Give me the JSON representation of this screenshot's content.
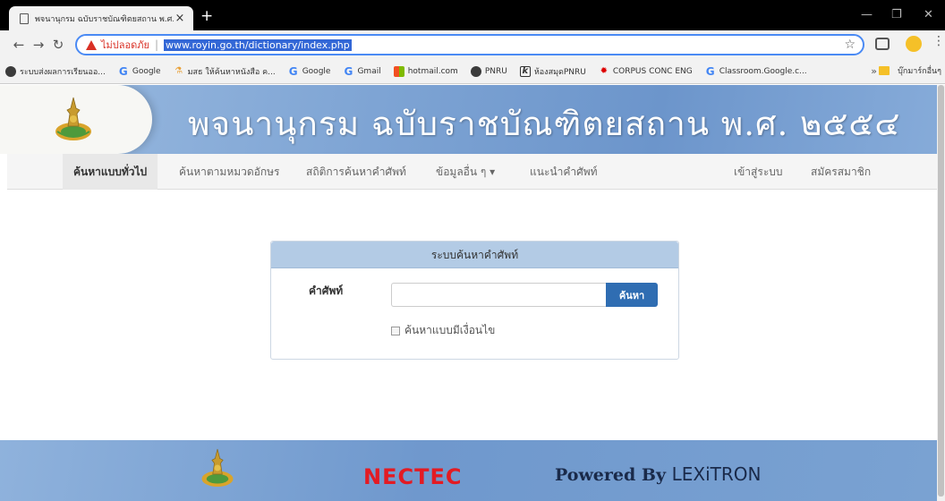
{
  "browser": {
    "tab_title": "พจนานุกรม ฉบับราชบัณฑิตยสถาน พ.ศ.",
    "close_glyph": "×",
    "newtab_glyph": "+",
    "security_warning": "ไม่ปลอดภัย",
    "url": "www.royin.go.th/dictionary/index.php",
    "bookmarks": [
      {
        "label": "ระบบส่งผลการเรียนออ...",
        "icon": "circle-icon"
      },
      {
        "label": "Google",
        "icon": "google-icon"
      },
      {
        "label": "มสธ ให้ค้นหาหนังสือ ค...",
        "icon": "flask-icon"
      },
      {
        "label": "Google",
        "icon": "google-icon"
      },
      {
        "label": "Gmail",
        "icon": "google-icon"
      },
      {
        "label": "hotmail.com",
        "icon": "windows-icon"
      },
      {
        "label": "PNRU",
        "icon": "circle-icon"
      },
      {
        "label": "ห้องสมุดPNRU",
        "icon": "k-icon"
      },
      {
        "label": "CORPUS CONC ENG",
        "icon": "maple-leaf-icon"
      },
      {
        "label": "Classroom.Google.c...",
        "icon": "google-icon"
      }
    ],
    "bookmarks_overflow": "»",
    "other_bookmarks": "บุ๊กมาร์กอื่นๆ"
  },
  "header": {
    "title": "พจนานุกรม ฉบับราชบัณฑิตยสถาน พ.ศ. ๒๕๕๔"
  },
  "nav": {
    "items": [
      {
        "label": "ค้นหาแบบทั่วไป",
        "active": true
      },
      {
        "label": "ค้นหาตามหมวดอักษร"
      },
      {
        "label": "สถิติการค้นหาคำศัพท์"
      },
      {
        "label": "ข้อมูลอื่น ๆ ▾"
      },
      {
        "label": "แนะนำคำศัพท์"
      }
    ],
    "login": "เข้าสู่ระบบ",
    "register": "สมัครสมาชิก"
  },
  "search": {
    "panel_title": "ระบบค้นหาคำศัพท์",
    "word_label": "คำศัพท์",
    "input_value": "",
    "button_label": "ค้นหา",
    "conditional_label": "ค้นหาแบบมีเงื่อนไข",
    "conditional_checked": false
  },
  "footer": {
    "nectec": "NECTEC",
    "powered_by": "Powered By ",
    "lexitron": "LEXiTRON"
  },
  "colors": {
    "accent": "#2f6db2",
    "panel_header": "#b3cbe5",
    "warning": "#d93025"
  }
}
